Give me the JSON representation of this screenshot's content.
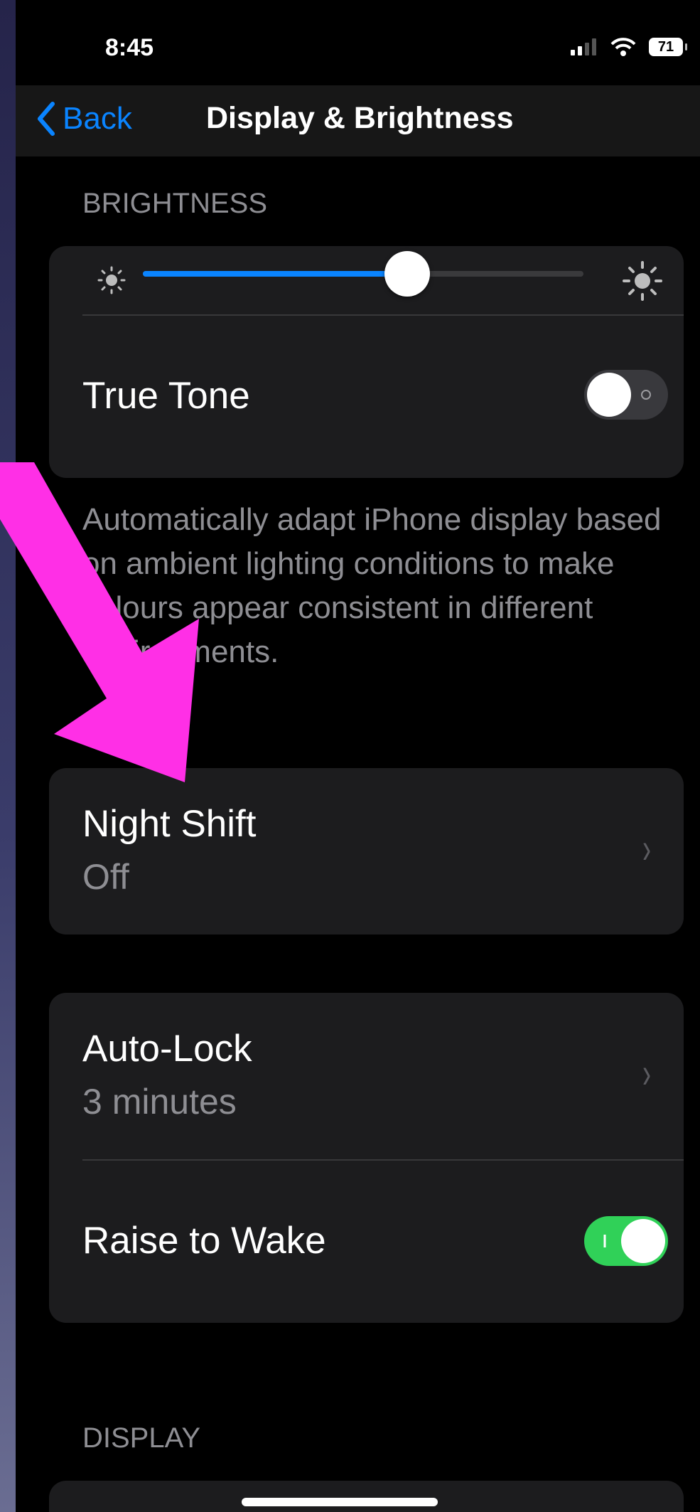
{
  "status_bar": {
    "time": "8:45",
    "battery": "71"
  },
  "navbar": {
    "back_label": "Back",
    "title": "Display & Brightness"
  },
  "brightness": {
    "section_header": "BRIGHTNESS",
    "level": 0.6,
    "true_tone": {
      "label": "True Tone",
      "on": false
    },
    "footnote": "Automatically adapt iPhone display based on ambient lighting conditions to make colours appear consistent in different environments."
  },
  "night_shift": {
    "label": "Night Shift",
    "value": "Off"
  },
  "auto_lock": {
    "label": "Auto-Lock",
    "value": "3 minutes"
  },
  "raise_to_wake": {
    "label": "Raise to Wake",
    "on": true
  },
  "display": {
    "section_header": "DISPLAY"
  },
  "colors": {
    "accent": "#0a84ff",
    "toggle_on": "#30d158",
    "annotation_arrow": "#ff2fe6"
  },
  "icons": [
    "chevron-left-icon",
    "signal-icon",
    "wifi-icon",
    "battery-icon",
    "sun-small-icon",
    "sun-large-icon",
    "chevron-right-icon",
    "annotation-arrow"
  ]
}
